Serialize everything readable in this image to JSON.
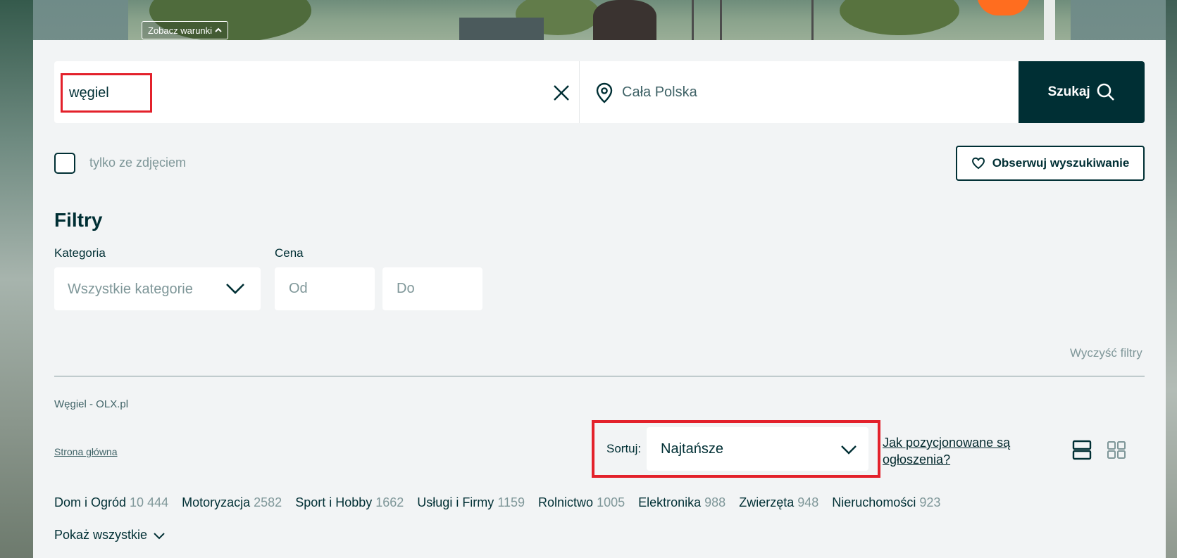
{
  "banner": {
    "conditions_label": "Zobacz warunki"
  },
  "search": {
    "query_value": "węgiel",
    "location_placeholder": "Cała Polska",
    "search_button_label": "Szukaj"
  },
  "options": {
    "photo_only_label": "tylko ze zdjęciem",
    "observe_label": "Obserwuj wyszukiwanie"
  },
  "filters": {
    "title": "Filtry",
    "category_label": "Kategoria",
    "category_value": "Wszystkie kategorie",
    "price_label": "Cena",
    "price_from_placeholder": "Od",
    "price_to_placeholder": "Do",
    "clear_label": "Wyczyść filtry"
  },
  "results": {
    "heading": "Węgiel - OLX.pl",
    "breadcrumb_home": "Strona główna",
    "sort_label": "Sortuj:",
    "sort_value": "Najtańsze",
    "ranking_link": "Jak pozycjonowane są ogłoszenia?",
    "categories": [
      {
        "name": "Dom i Ogród",
        "count": "10 444"
      },
      {
        "name": "Motoryzacja",
        "count": "2582"
      },
      {
        "name": "Sport i Hobby",
        "count": "1662"
      },
      {
        "name": "Usługi i Firmy",
        "count": "1159"
      },
      {
        "name": "Rolnictwo",
        "count": "1005"
      },
      {
        "name": "Elektronika",
        "count": "988"
      },
      {
        "name": "Zwierzęta",
        "count": "948"
      },
      {
        "name": "Nieruchomości",
        "count": "923"
      }
    ],
    "show_all_label": "Pokaż wszystkie"
  },
  "colors": {
    "primary": "#002f34",
    "muted": "#7f9799",
    "highlight": "#e3212b",
    "panel_bg": "#f2f4f5"
  }
}
